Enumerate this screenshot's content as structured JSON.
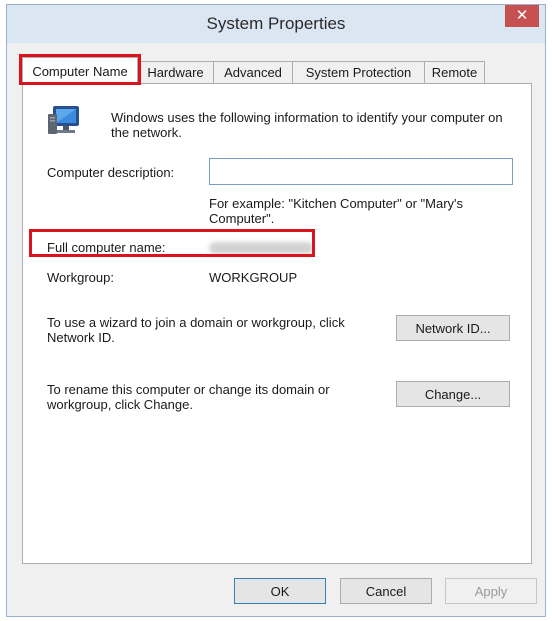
{
  "window": {
    "title": "System Properties",
    "close_glyph": "✕"
  },
  "tabs": [
    {
      "label": "Computer Name",
      "active": true
    },
    {
      "label": "Hardware",
      "active": false
    },
    {
      "label": "Advanced",
      "active": false
    },
    {
      "label": "System Protection",
      "active": false
    },
    {
      "label": "Remote",
      "active": false
    }
  ],
  "computer_name_tab": {
    "intro_text": "Windows uses the following information to identify your computer on the network.",
    "description_label": "Computer description:",
    "description_value": "",
    "example_text": "For example: \"Kitchen Computer\" or \"Mary's Computer\".",
    "full_name_label": "Full computer name:",
    "full_name_value": "",
    "workgroup_label": "Workgroup:",
    "workgroup_value": "WORKGROUP",
    "network_id_text": "To use a wizard to join a domain or workgroup, click Network ID.",
    "network_id_button": "Network ID...",
    "rename_text": "To rename this computer or change its domain or workgroup, click Change.",
    "change_button": "Change..."
  },
  "footer": {
    "ok_label": "OK",
    "cancel_label": "Cancel",
    "apply_label": "Apply"
  },
  "colors": {
    "highlight": "#d9141c",
    "close_button": "#c75050",
    "titlebar": "#dbe6f3"
  },
  "icons": {
    "computer": "computer-icon",
    "close": "close-icon"
  }
}
